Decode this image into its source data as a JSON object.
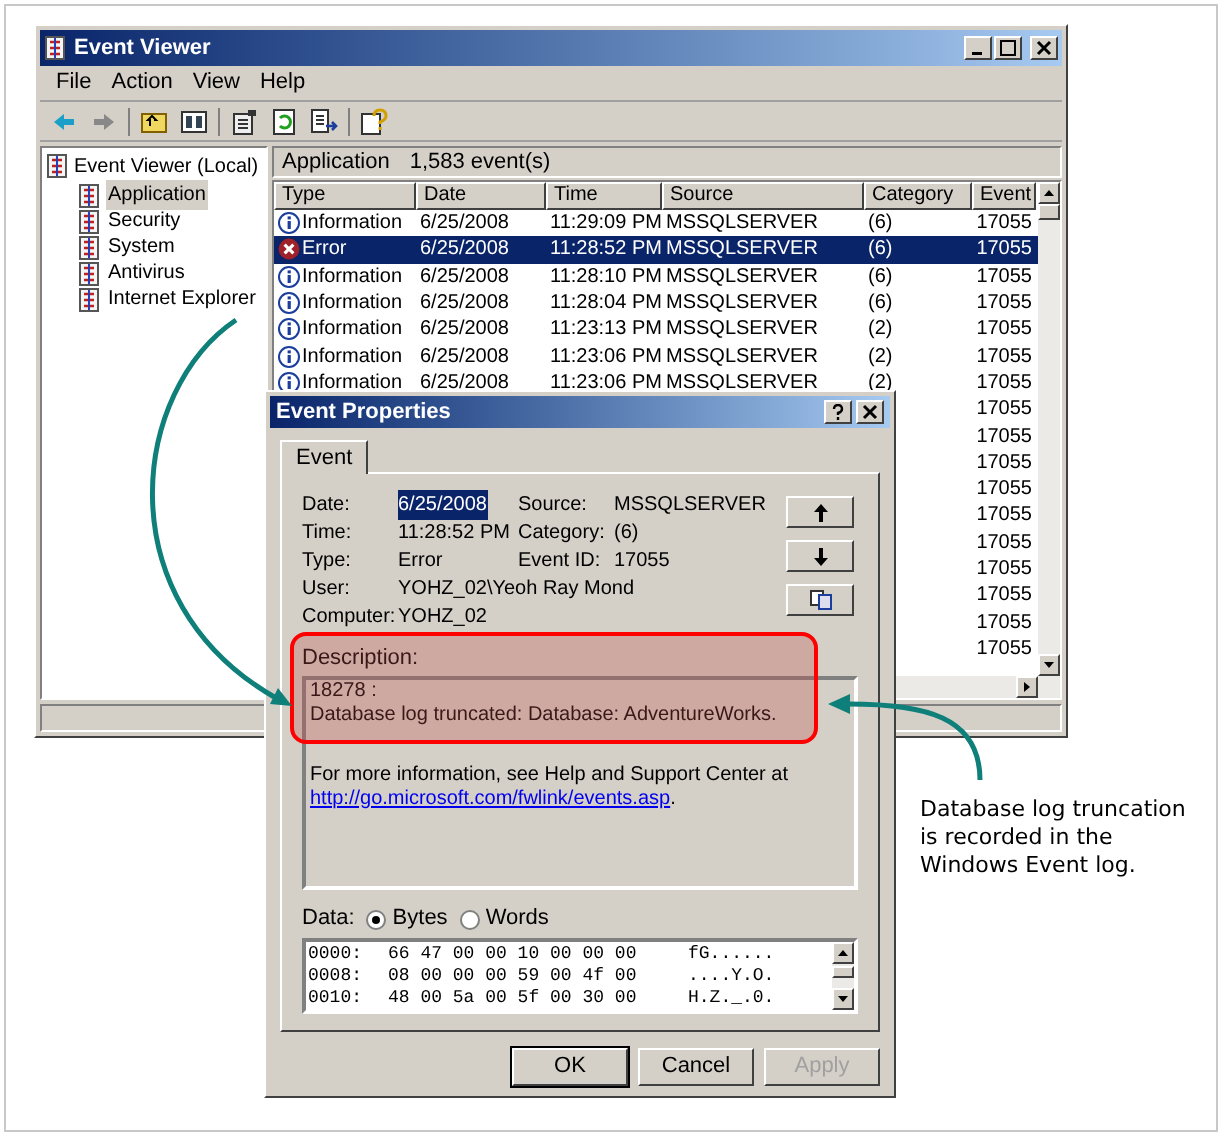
{
  "window": {
    "title": "Event Viewer"
  },
  "menu": [
    "File",
    "Action",
    "View",
    "Help"
  ],
  "tree": {
    "label": "Event Viewer (Local)",
    "children": [
      {
        "label": "Application",
        "selected": true
      },
      {
        "label": "Security",
        "selected": false
      },
      {
        "label": "System",
        "selected": false
      },
      {
        "label": "Antivirus",
        "selected": false
      },
      {
        "label": "Internet Explorer",
        "selected": false
      }
    ]
  },
  "list_header": {
    "name": "Application",
    "count": "1,583 event(s)"
  },
  "table": {
    "columns": [
      "Type",
      "Date",
      "Time",
      "Source",
      "Category",
      "Event"
    ],
    "rows": [
      {
        "kind": "info",
        "type": "Information",
        "date": "6/25/2008",
        "time": "11:29:09 PM",
        "source": "MSSQLSERVER",
        "category": "(6)",
        "event": "17055",
        "selected": false
      },
      {
        "kind": "error",
        "type": "Error",
        "date": "6/25/2008",
        "time": "11:28:52 PM",
        "source": "MSSQLSERVER",
        "category": "(6)",
        "event": "17055",
        "selected": true
      },
      {
        "kind": "info",
        "type": "Information",
        "date": "6/25/2008",
        "time": "11:28:10 PM",
        "source": "MSSQLSERVER",
        "category": "(6)",
        "event": "17055",
        "selected": false
      },
      {
        "kind": "info",
        "type": "Information",
        "date": "6/25/2008",
        "time": "11:28:04 PM",
        "source": "MSSQLSERVER",
        "category": "(6)",
        "event": "17055",
        "selected": false
      },
      {
        "kind": "info",
        "type": "Information",
        "date": "6/25/2008",
        "time": "11:23:13 PM",
        "source": "MSSQLSERVER",
        "category": "(2)",
        "event": "17055",
        "selected": false
      },
      {
        "kind": "info",
        "type": "Information",
        "date": "6/25/2008",
        "time": "11:23:06 PM",
        "source": "MSSQLSERVER",
        "category": "(2)",
        "event": "17055",
        "selected": false
      },
      {
        "kind": "info",
        "type": "Information",
        "date": "6/25/2008",
        "time": "11:23:06 PM",
        "source": "MSSQLSERVER",
        "category": "(2)",
        "event": "17055",
        "selected": false
      },
      {
        "kind": "hidden",
        "event": "17055",
        "selected": false
      },
      {
        "kind": "hidden",
        "event": "17055",
        "selected": false
      },
      {
        "kind": "hidden",
        "event": "17055",
        "selected": false
      },
      {
        "kind": "hidden",
        "event": "17055",
        "selected": false
      },
      {
        "kind": "hidden",
        "event": "17055",
        "selected": false
      },
      {
        "kind": "hidden",
        "event": "17055",
        "selected": false
      },
      {
        "kind": "hidden",
        "event": "17055",
        "selected": false
      },
      {
        "kind": "hidden",
        "event": "17055",
        "selected": false
      },
      {
        "kind": "hidden",
        "event": "17055",
        "selected": false
      },
      {
        "kind": "hidden",
        "event": "17055",
        "selected": false
      }
    ]
  },
  "dialog": {
    "title": "Event Properties",
    "tabs": [
      {
        "label": "Event",
        "selected": true
      }
    ],
    "fields": [
      {
        "label": "Date:",
        "value": "6/25/2008",
        "highlighted": true
      },
      {
        "label": "Time:",
        "value": "11:28:52 PM",
        "highlighted": false
      },
      {
        "label": "Type:",
        "value": "Error",
        "highlighted": false
      },
      {
        "label": "User:",
        "value": "YOHZ_02\\Yeoh Ray Mond",
        "highlighted": false
      },
      {
        "label": "Computer:",
        "value": "YOHZ_02",
        "highlighted": false
      }
    ],
    "side_fields": [
      {
        "label": "Source:",
        "value": "MSSQLSERVER"
      },
      {
        "label": "Category:",
        "value": "(6)"
      },
      {
        "label": "Event ID:",
        "value": "17055"
      }
    ],
    "description_label": "Description:",
    "description_lines": [
      "18278 :",
      "Database log truncated: Database: AdventureWorks."
    ],
    "more_info": "For more information, see Help and Support Center at",
    "link": "http://go.microsoft.com/fwlink/events.asp",
    "link_tail": ".",
    "data_label": "Data:",
    "radios": [
      {
        "label": "Bytes",
        "selected": true
      },
      {
        "label": "Words",
        "selected": false
      }
    ],
    "hex_lines": [
      {
        "offset": "0000:",
        "bytes": "66 47 00 00 10 00 00 00",
        "ascii": "fG......"
      },
      {
        "offset": "0008:",
        "bytes": "08 00 00 00 59 00 4f 00",
        "ascii": "....Y.O."
      },
      {
        "offset": "0010:",
        "bytes": "48 00 5a 00 5f 00 30 00",
        "ascii": "H.Z._.0."
      }
    ],
    "buttons": [
      {
        "label": "OK",
        "disabled": false
      },
      {
        "label": "Cancel",
        "disabled": false
      },
      {
        "label": "Apply",
        "disabled": true
      }
    ]
  },
  "annotation": "Database log truncation is recorded in the Windows Event log."
}
